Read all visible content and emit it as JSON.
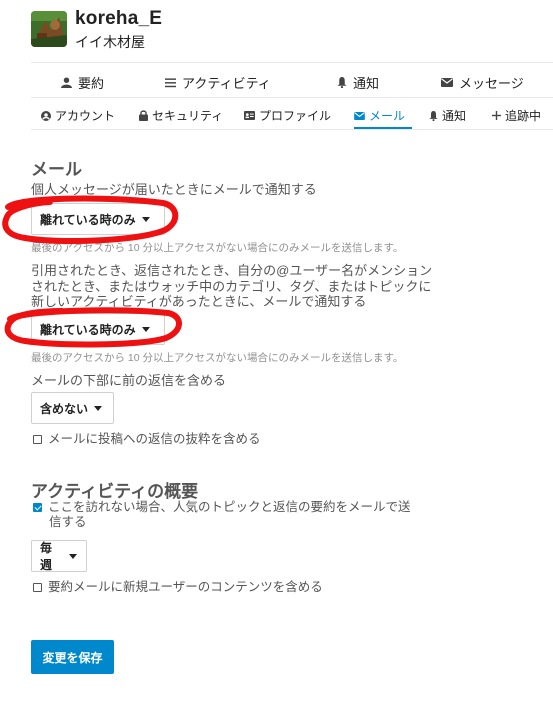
{
  "user": {
    "username": "koreha_E",
    "full_name": "イイ木材屋"
  },
  "main_nav": {
    "items": [
      {
        "label": "要約",
        "icon": "user-icon"
      },
      {
        "label": "アクティビティ",
        "icon": "list-icon"
      },
      {
        "label": "通知",
        "icon": "bell-icon"
      },
      {
        "label": "メッセージ",
        "icon": "envelope-icon"
      }
    ]
  },
  "sub_nav": {
    "items": [
      {
        "label": "アカウント",
        "icon": "user-circle-icon"
      },
      {
        "label": "セキュリティ",
        "icon": "lock-icon"
      },
      {
        "label": "プロファイル",
        "icon": "id-card-icon"
      },
      {
        "label": "メール",
        "icon": "envelope-icon",
        "active": true
      },
      {
        "label": "通知",
        "icon": "bell-icon"
      },
      {
        "label": "追跡中",
        "icon": "plus-icon"
      }
    ],
    "active_color": "#0088cc"
  },
  "email_section": {
    "title": "メール",
    "pm_label": "個人メッセージが届いたときにメールで通知する",
    "pm_value": "離れている時のみ",
    "pm_desc": "最後のアクセスから 10 分以上アクセスがない場合にのみメールを送信します。",
    "mention_label_line1": "引用されたとき、返信されたとき、自分の@ユーザー名がメンション",
    "mention_label_line2": "されたとき、またはウォッチ中のカテゴリ、タグ、またはトピックに",
    "mention_label_line3": "新しいアクティビティがあったときに、メールで通知する",
    "mention_value": "離れている時のみ",
    "mention_desc": "最後のアクセスから 10 分以上アクセスがない場合にのみメールを送信します。",
    "previous_replies_label": "メールの下部に前の返信を含める",
    "previous_replies_value": "含めない",
    "include_excerpt_label": "メールに投稿への返信の抜粋を含める",
    "include_excerpt_checked": false
  },
  "digest_section": {
    "title": "アクティビティの概要",
    "digest_checkbox_line1": "ここを訪れない場合、人気のトピックと返信の要約をメールで送",
    "digest_checkbox_line2": "信する",
    "digest_checked": true,
    "digest_frequency": "毎週",
    "new_users_label": "要約メールに新規ユーザーのコンテンツを含める",
    "new_users_checked": false
  },
  "save_button_label": "変更を保存",
  "colors": {
    "primary": "#0088cc",
    "annotation_red": "#ee1111"
  }
}
